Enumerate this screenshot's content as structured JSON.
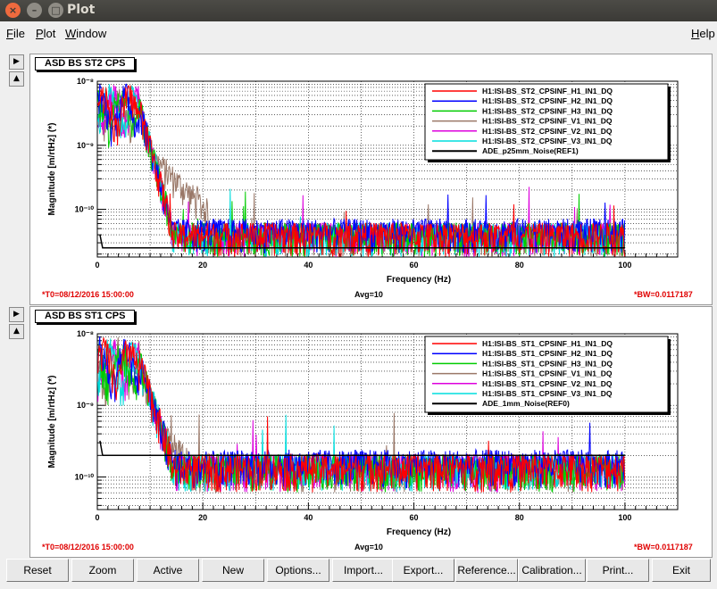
{
  "window": {
    "title": "Plot",
    "close_glyph": "×",
    "min_glyph": "–",
    "max_glyph": "□"
  },
  "menubar": {
    "file": {
      "key": "F",
      "rest": "ile"
    },
    "plot": {
      "key": "P",
      "rest": "lot"
    },
    "window": {
      "key": "W",
      "rest": "indow"
    },
    "help": {
      "key": "H",
      "rest": "elp"
    }
  },
  "tab_glyphs": {
    "next": "▶",
    "up": "▲"
  },
  "panels": [
    {
      "graph_title": "ASD BS ST2 CPS",
      "t0": "*T0=08/12/2016 15:00:00",
      "avg": "Avg=10",
      "bw": "*BW=0.0117187"
    },
    {
      "graph_title": "ASD BS ST1 CPS",
      "t0": "*T0=08/12/2016 15:00:00",
      "avg": "Avg=10",
      "bw": "*BW=0.0117187"
    }
  ],
  "chart_data": [
    {
      "type": "line",
      "xlabel": "Frequency (Hz)",
      "ylabel": "Magnitude [m/rtHz] (*)",
      "xlim": [
        0,
        110
      ],
      "ylim": [
        1.8e-11,
        1e-08
      ],
      "yscale": "log",
      "grid": true,
      "legend_position": "top-right",
      "x_ticks": [
        "0",
        "20",
        "40",
        "60",
        "80",
        "100"
      ],
      "y_ticks": [
        "10⁻⁸",
        "10⁻⁹",
        "10⁻¹⁰"
      ],
      "series": [
        {
          "name": "H1:ISI-BS_ST2_CPSINF_H1_IN1_DQ",
          "color": "#ff0000"
        },
        {
          "name": "H1:ISI-BS_ST2_CPSINF_H2_IN1_DQ",
          "color": "#0000ff"
        },
        {
          "name": "H1:ISI-BS_ST2_CPSINF_H3_IN1_DQ",
          "color": "#00cc00"
        },
        {
          "name": "H1:ISI-BS_ST2_CPSINF_V1_IN1_DQ",
          "color": "#9a7868"
        },
        {
          "name": "H1:ISI-BS_ST2_CPSINF_V2_IN1_DQ",
          "color": "#dd00dd"
        },
        {
          "name": "H1:ISI-BS_ST2_CPSINF_V3_IN1_DQ",
          "color": "#00dddd"
        },
        {
          "name": "ADE_p25mm_Noise(REF1)",
          "color": "#000000"
        }
      ],
      "ref_level": 2.5e-11
    },
    {
      "type": "line",
      "xlabel": "Frequency (Hz)",
      "ylabel": "Magnitude [m/rtHz] (*)",
      "xlim": [
        0,
        110
      ],
      "ylim": [
        3.5e-11,
        1e-08
      ],
      "yscale": "log",
      "grid": true,
      "legend_position": "top-right",
      "x_ticks": [
        "0",
        "20",
        "40",
        "60",
        "80",
        "100"
      ],
      "y_ticks": [
        "10⁻⁸",
        "10⁻⁹",
        "10⁻¹⁰"
      ],
      "series": [
        {
          "name": "H1:ISI-BS_ST1_CPSINF_H1_IN1_DQ",
          "color": "#ff0000"
        },
        {
          "name": "H1:ISI-BS_ST1_CPSINF_H2_IN1_DQ",
          "color": "#0000ff"
        },
        {
          "name": "H1:ISI-BS_ST1_CPSINF_H3_IN1_DQ",
          "color": "#00cc00"
        },
        {
          "name": "H1:ISI-BS_ST1_CPSINF_V1_IN1_DQ",
          "color": "#9a7868"
        },
        {
          "name": "H1:ISI-BS_ST1_CPSINF_V2_IN1_DQ",
          "color": "#dd00dd"
        },
        {
          "name": "H1:ISI-BS_ST1_CPSINF_V3_IN1_DQ",
          "color": "#00dddd"
        },
        {
          "name": "ADE_1mm_Noise(REF0)",
          "color": "#000000"
        }
      ],
      "ref_level": 2e-10
    }
  ],
  "buttons": [
    "Reset",
    "Zoom",
    "Active",
    "New",
    "Options...",
    "Import...",
    "Export...",
    "Reference...",
    "Calibration...",
    "Print...",
    "Exit"
  ]
}
